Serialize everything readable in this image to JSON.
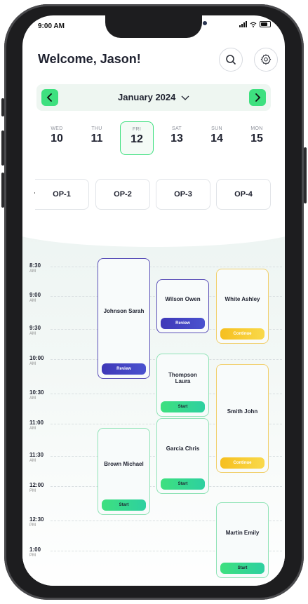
{
  "status": {
    "time": "9:00 AM"
  },
  "header": {
    "welcome": "Welcome, Jason!"
  },
  "month": {
    "label": "January 2024"
  },
  "days": [
    {
      "dow": "WED",
      "num": "10"
    },
    {
      "dow": "THU",
      "num": "11"
    },
    {
      "dow": "FRI",
      "num": "12",
      "selected": true
    },
    {
      "dow": "SAT",
      "num": "13"
    },
    {
      "dow": "SUN",
      "num": "14"
    },
    {
      "dow": "MON",
      "num": "15"
    }
  ],
  "ops": [
    "OP-1",
    "OP-2",
    "OP-3",
    "OP-4"
  ],
  "times": [
    {
      "t": "8:30",
      "ap": "AM"
    },
    {
      "t": "9:00",
      "ap": "AM"
    },
    {
      "t": "9:30",
      "ap": "AM"
    },
    {
      "t": "10:00",
      "ap": "AM"
    },
    {
      "t": "10:30",
      "ap": "AM"
    },
    {
      "t": "11:00",
      "ap": "AM"
    },
    {
      "t": "11:30",
      "ap": "AM"
    },
    {
      "t": "12:00",
      "ap": "PM"
    },
    {
      "t": "12:30",
      "ap": "PM"
    },
    {
      "t": "1:00",
      "ap": "PM"
    }
  ],
  "appointments": [
    {
      "name": "Johnson Sarah",
      "action": "Review",
      "style": "purple"
    },
    {
      "name": "Wilson Owen",
      "action": "Review",
      "style": "purple"
    },
    {
      "name": "White Ashley",
      "action": "Continue",
      "style": "yellow"
    },
    {
      "name": "Thompson Laura",
      "action": "Start",
      "style": "green"
    },
    {
      "name": "Smith John",
      "action": "Continue",
      "style": "yellow"
    },
    {
      "name": "Garcia Chris",
      "action": "Start",
      "style": "green"
    },
    {
      "name": "Brown Michael",
      "action": "Start",
      "style": "green"
    },
    {
      "name": "Martin Emily",
      "action": "Start",
      "style": "green"
    }
  ],
  "colors": {
    "accent": "#3ee07f",
    "purple": "#4a44c6",
    "yellow": "#f6c02a"
  }
}
